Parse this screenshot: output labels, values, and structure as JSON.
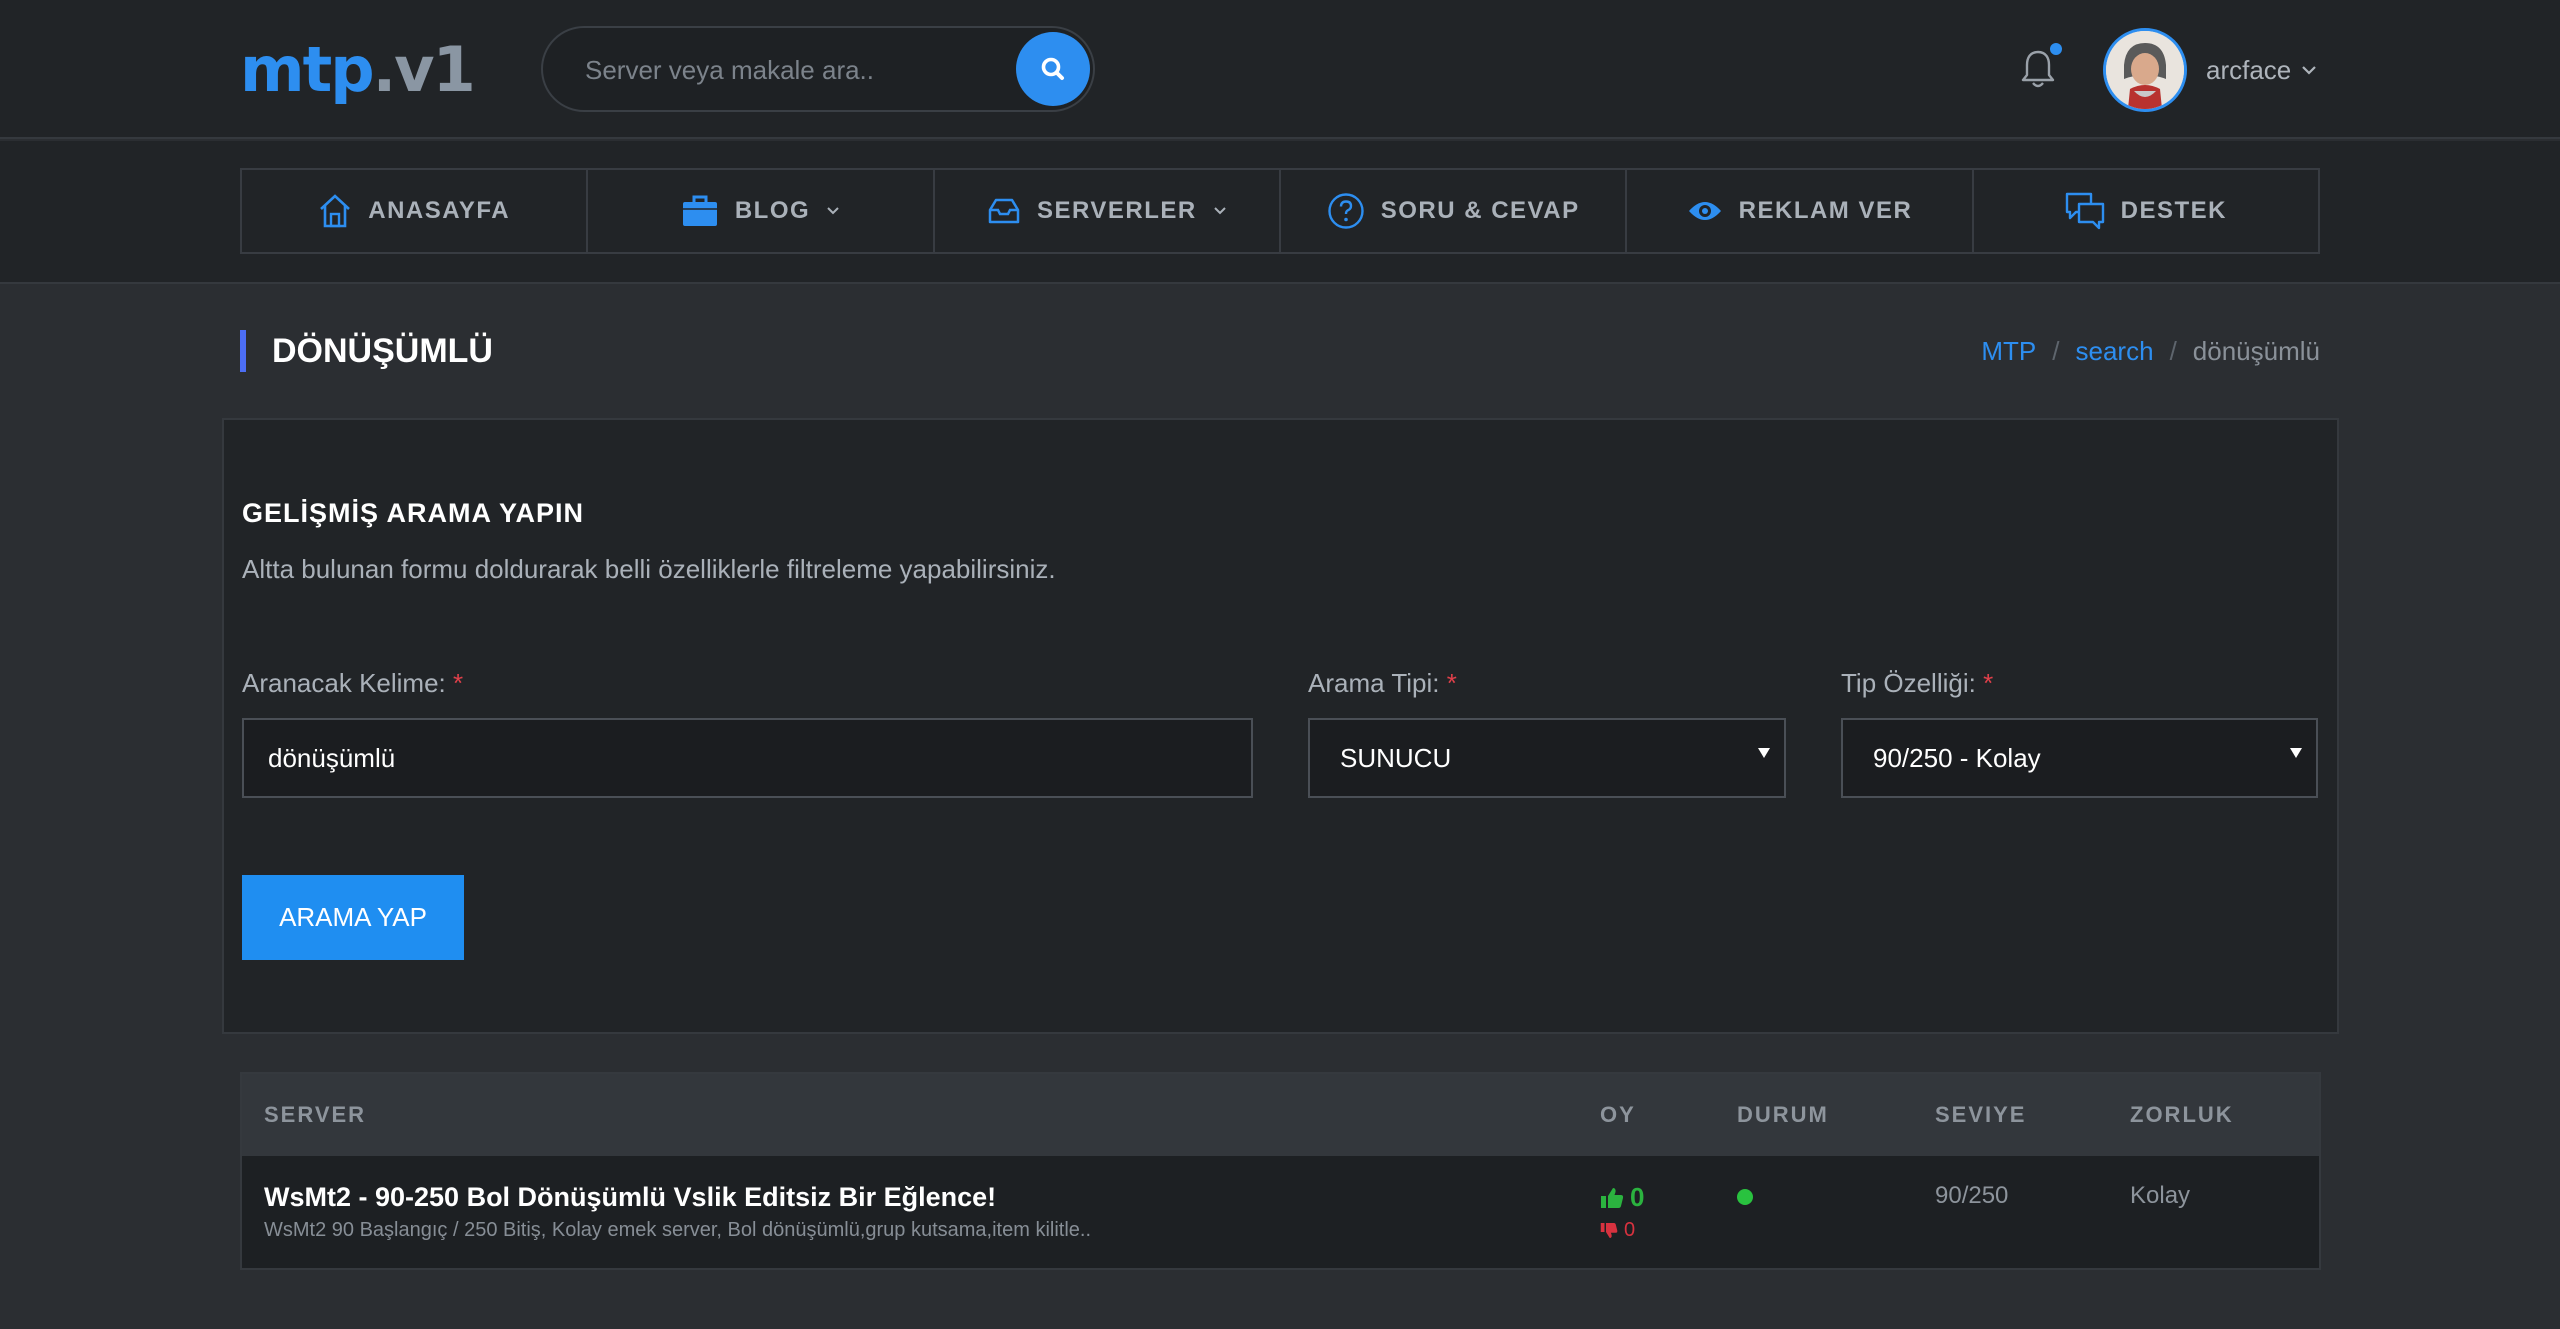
{
  "header": {
    "logo_main": "mtp",
    "logo_suffix": ".v1",
    "search_placeholder": "Server veya makale ara..",
    "username": "arcface"
  },
  "icons": {
    "search": "search-icon",
    "bell": "bell-icon",
    "user_dropdown": "chevron-down-icon",
    "home": "home-icon",
    "blog": "briefcase-icon",
    "servers": "inbox-icon",
    "faq": "question-circle-icon",
    "ads": "eye-icon",
    "support": "chat-bubbles-icon",
    "vote_up": "thumbs-up-icon",
    "vote_down": "thumbs-down-icon"
  },
  "nav": [
    {
      "label": "ANASAYFA",
      "dropdown": false
    },
    {
      "label": "BLOG",
      "dropdown": true
    },
    {
      "label": "SERVERLER",
      "dropdown": true
    },
    {
      "label": "SORU & CEVAP",
      "dropdown": false
    },
    {
      "label": "REKLAM VER",
      "dropdown": false
    },
    {
      "label": "DESTEK",
      "dropdown": false
    }
  ],
  "page": {
    "title": "DÖNÜŞÜMLÜ",
    "breadcrumb": [
      {
        "label": "MTP"
      },
      {
        "label": "search"
      },
      {
        "label": "dönüşümlü"
      }
    ]
  },
  "search_form": {
    "title": "GELİŞMİŞ ARAMA YAPIN",
    "description": "Altta bulunan formu doldurarak belli özelliklerle filtreleme yapabilirsiniz.",
    "keyword_label": "Aranacak Kelime:",
    "keyword_value": "dönüşümlü",
    "type_label": "Arama Tipi:",
    "type_value": "SUNUCU",
    "feature_label": "Tip Özelliği:",
    "feature_value": "90/250 - Kolay",
    "required_mark": "*",
    "submit_label": "ARAMA YAP"
  },
  "table": {
    "columns": [
      "SERVER",
      "OY",
      "DURUM",
      "SEVIYE",
      "ZORLUK"
    ],
    "rows": [
      {
        "title": "WsMt2 - 90-250 Bol Dönüşümlü Vslik Editsiz Bir Eğlence!",
        "description": "WsMt2 90 Başlangıç / 250 Bitiş, Kolay emek server, Bol dönüşümlü,grup kutsama,item kilitle..",
        "votes_up": "0",
        "votes_down": "0",
        "status": "online",
        "level": "90/250",
        "difficulty": "Kolay"
      }
    ]
  },
  "colors": {
    "accent": "#2d8ef0",
    "title_bar": "#4c6ef5",
    "required": "#e0404a",
    "vote_up": "#2bb33f",
    "vote_down": "#d8323f",
    "status_online": "#29c23f"
  }
}
